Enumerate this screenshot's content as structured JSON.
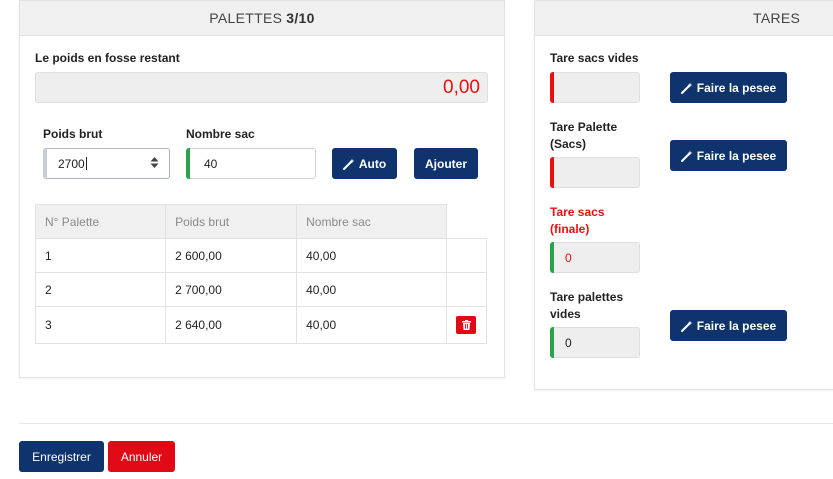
{
  "palettes": {
    "header_prefix": "PALETTES",
    "header_count": "3/10",
    "remaining_label": "Le poids en fosse restant",
    "remaining_value": "0,00",
    "gross_label": "Poids brut",
    "gross_value": "2700",
    "bags_label": "Nombre sac",
    "bags_value": "40",
    "auto_label": "Auto",
    "add_label": "Ajouter",
    "table": {
      "columns": [
        "N° Palette",
        "Poids brut",
        "Nombre sac"
      ],
      "rows": [
        [
          "1",
          "2 600,00",
          "40,00"
        ],
        [
          "2",
          "2 700,00",
          "40,00"
        ],
        [
          "3",
          "2 640,00",
          "40,00"
        ]
      ]
    }
  },
  "tares": {
    "header": "TARES",
    "empty_bags_label": "Tare sacs vides",
    "pallet_bags_label_l1": "Tare Palette",
    "pallet_bags_label_l2": "(Sacs)",
    "final_bags_label_l1": "Tare sacs",
    "final_bags_label_l2": "(finale)",
    "final_bags_value": "0",
    "empty_pallets_label_l1": "Tare palettes",
    "empty_pallets_label_l2": "vides",
    "empty_pallets_value": "0",
    "weigh_label": "Faire la pesee"
  },
  "footer": {
    "save_label": "Enregistrer",
    "cancel_label": "Annuler"
  },
  "colors": {
    "primary": "#0f346d",
    "danger": "#e00a17",
    "success": "#2aa14a"
  }
}
